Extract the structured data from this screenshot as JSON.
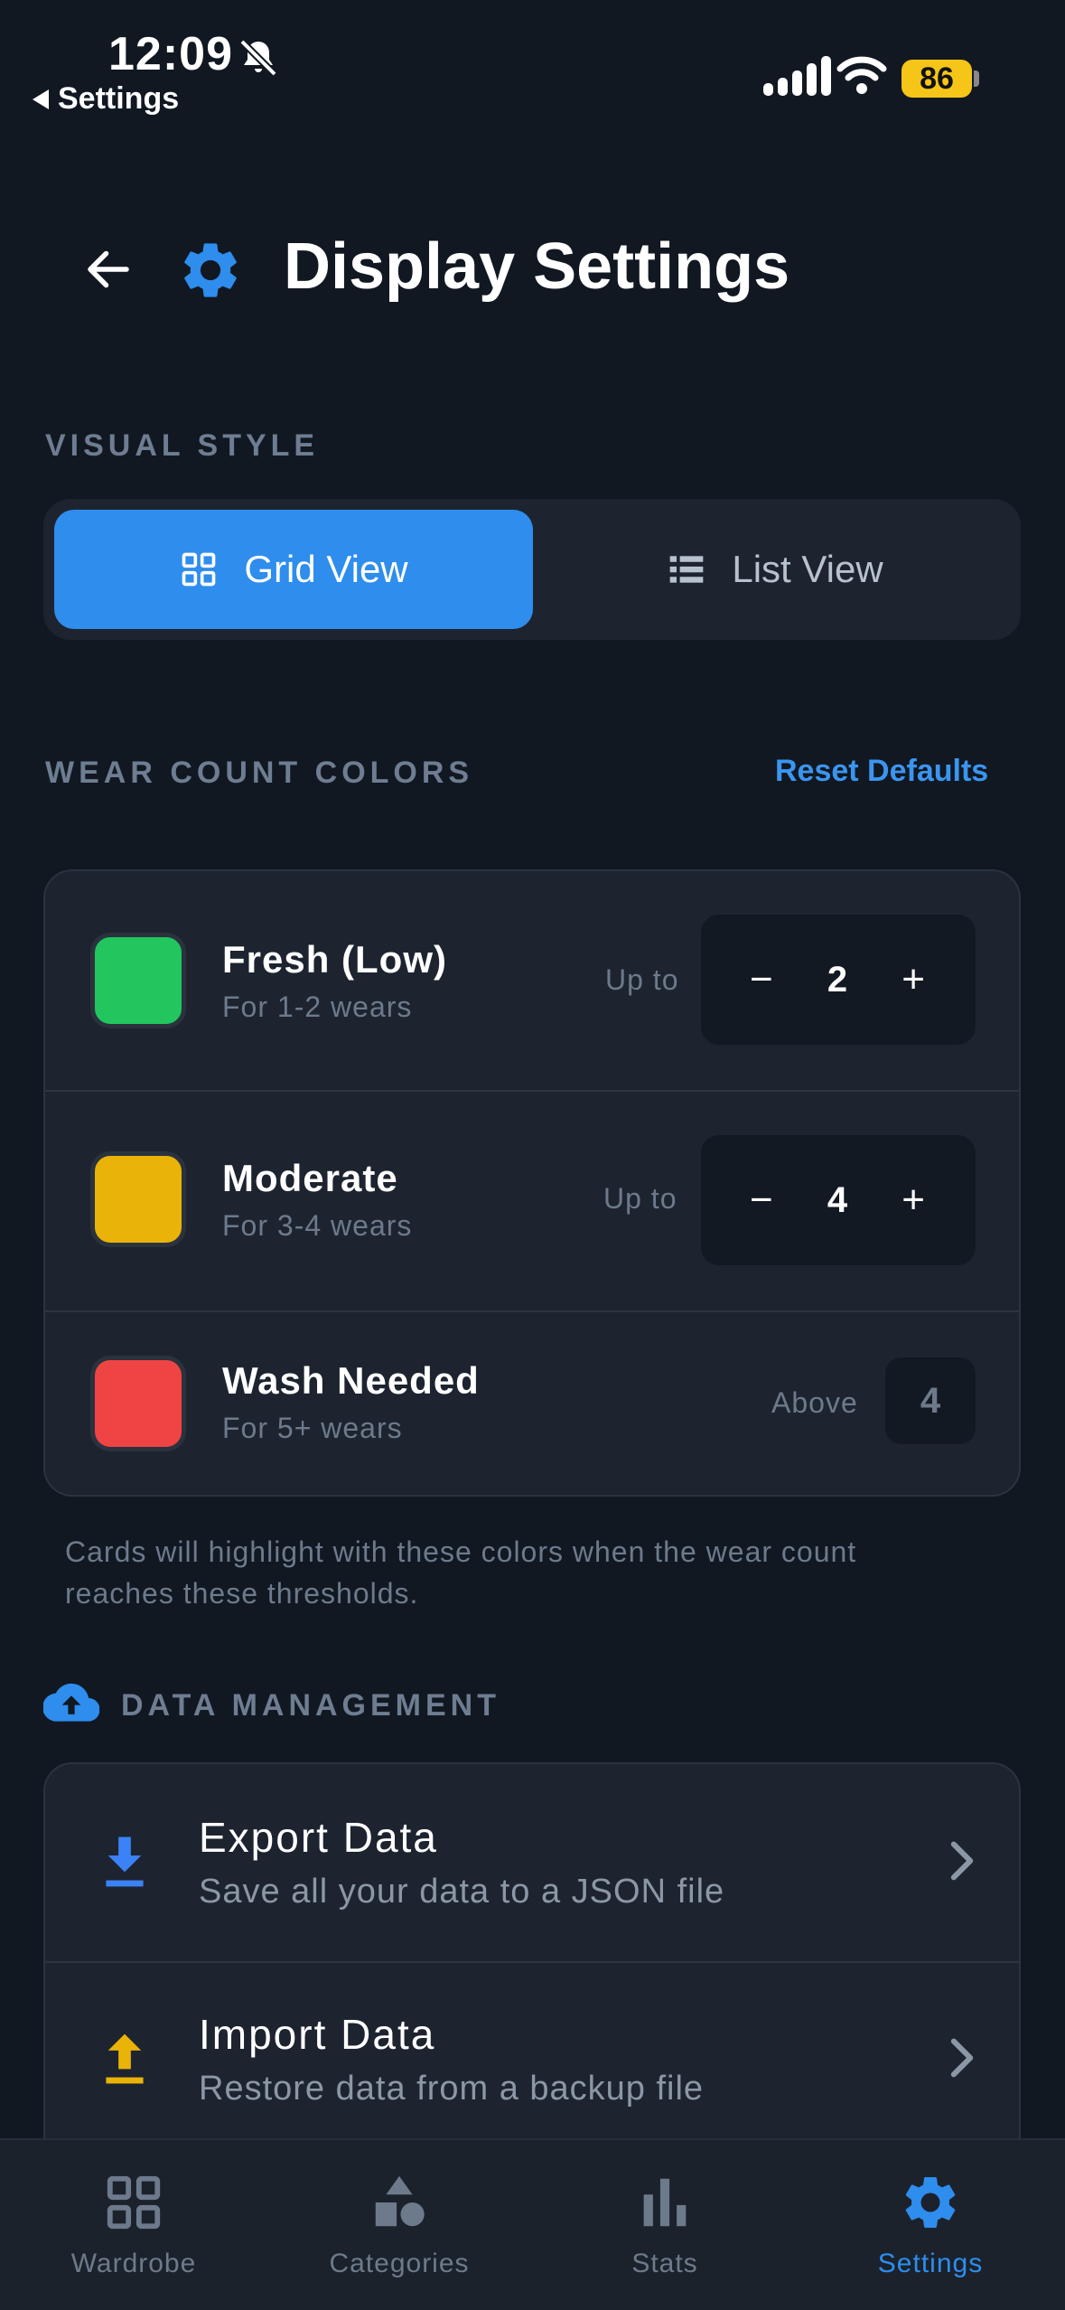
{
  "status_bar": {
    "time": "12:09",
    "back_app": "Settings",
    "battery": "86"
  },
  "header": {
    "title": "Display Settings"
  },
  "visual_style": {
    "label": "VISUAL STYLE",
    "options": [
      {
        "label": "Grid View",
        "icon": "grid-icon",
        "selected": true
      },
      {
        "label": "List View",
        "icon": "list-icon",
        "selected": false
      }
    ],
    "accent_color": "#2e8ded"
  },
  "wear_colors": {
    "label": "WEAR COUNT COLORS",
    "reset_label": "Reset Defaults",
    "rows": [
      {
        "title": "Fresh (Low)",
        "subtitle": "For 1-2 wears",
        "prefix": "Up to",
        "value": "2",
        "color": "#22c55e",
        "minus": "−",
        "plus": "+"
      },
      {
        "title": "Moderate",
        "subtitle": "For 3-4 wears",
        "prefix": "Up to",
        "value": "4",
        "color": "#eab308",
        "minus": "−",
        "plus": "+"
      },
      {
        "title": "Wash Needed",
        "subtitle": "For 5+ wears",
        "prefix": "Above",
        "value": "4",
        "color": "#ef4444"
      }
    ],
    "help_text": "Cards will highlight with these colors when the wear count reaches these thresholds."
  },
  "data_management": {
    "label": "DATA MANAGEMENT",
    "items": [
      {
        "title": "Export Data",
        "subtitle": "Save all your data to a JSON file",
        "icon": "download-icon",
        "icon_color": "#3b82f6"
      },
      {
        "title": "Import Data",
        "subtitle": "Restore data from a backup file",
        "icon": "upload-icon",
        "icon_color": "#eab308"
      }
    ]
  },
  "tabs": [
    {
      "label": "Wardrobe",
      "icon": "wardrobe-grid-icon",
      "active": false
    },
    {
      "label": "Categories",
      "icon": "shapes-icon",
      "active": false
    },
    {
      "label": "Stats",
      "icon": "bar-chart-icon",
      "active": false
    },
    {
      "label": "Settings",
      "icon": "gear-icon",
      "active": true
    }
  ]
}
